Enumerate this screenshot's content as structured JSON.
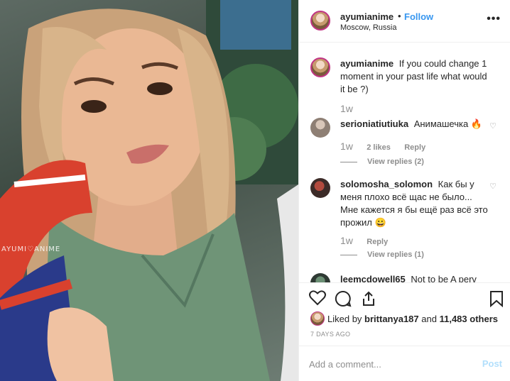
{
  "photo": {
    "watermark": "AYUMI♡ANIME"
  },
  "header": {
    "username": "ayumianime",
    "separator": "•",
    "follow_label": "Follow",
    "location": "Moscow, Russia",
    "more_icon": "more-horizontal-icon"
  },
  "caption": {
    "username": "ayumianime",
    "text": "If you could change 1 moment in your past life what would it be ?)",
    "time": "1w"
  },
  "comments": [
    {
      "username": "serioniatiutiuka",
      "text": "Анимашечка 🔥",
      "time": "1w",
      "likes": "2 likes",
      "reply_label": "Reply",
      "view_replies": "View replies (2)"
    },
    {
      "username": "solomosha_solomon",
      "text": "Как бы у меня плохо всё щас не было... Мне кажется я бы ещё раз всё это прожил 😀",
      "time": "1w",
      "reply_label": "Reply",
      "view_replies": "View replies (1)"
    },
    {
      "username": "leemcdowell65",
      "text": "Not to be A perv"
    }
  ],
  "likes": {
    "prefix": "Liked by",
    "user": "brittanya187",
    "joiner": "and",
    "count": "11,483 others"
  },
  "posted": "7 DAYS AGO",
  "add_comment": {
    "placeholder": "Add a comment...",
    "post_label": "Post"
  },
  "colors": {
    "accent": "#3897f0",
    "post_disabled": "#b2dffc",
    "muted": "#8e8e8e"
  }
}
